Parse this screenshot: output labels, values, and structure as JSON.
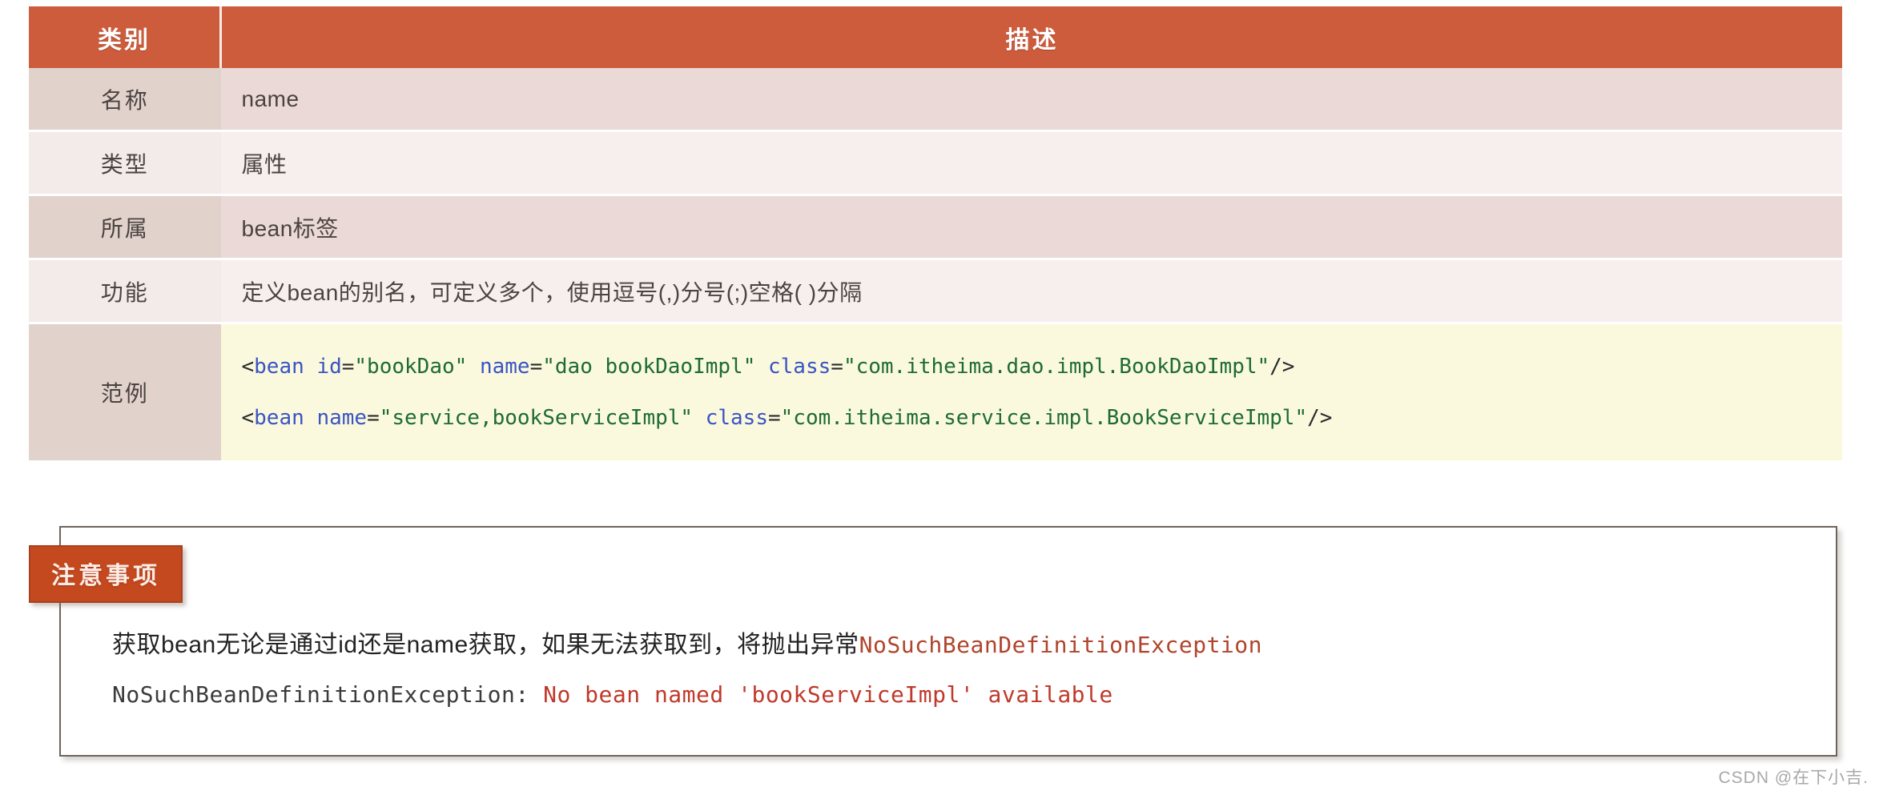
{
  "table": {
    "headers": [
      "类别",
      "描述"
    ],
    "rows": [
      {
        "category": "名称",
        "value": "name"
      },
      {
        "category": "类型",
        "value": "属性"
      },
      {
        "category": "所属",
        "value": "bean标签"
      },
      {
        "category": "功能",
        "value": "定义bean的别名，可定义多个，使用逗号(,)分号(;)空格( )分隔"
      }
    ],
    "example": {
      "category": "范例",
      "lines": [
        {
          "tokens": [
            {
              "t": "<",
              "k": "punc"
            },
            {
              "t": "bean",
              "k": "tag"
            },
            {
              "t": " ",
              "k": "punc"
            },
            {
              "t": "id",
              "k": "attr"
            },
            {
              "t": "=",
              "k": "punc"
            },
            {
              "t": "\"bookDao\"",
              "k": "str"
            },
            {
              "t": " ",
              "k": "punc"
            },
            {
              "t": "name",
              "k": "attr"
            },
            {
              "t": "=",
              "k": "punc"
            },
            {
              "t": "\"dao bookDaoImpl\"",
              "k": "str"
            },
            {
              "t": " ",
              "k": "punc"
            },
            {
              "t": "class",
              "k": "attr"
            },
            {
              "t": "=",
              "k": "punc"
            },
            {
              "t": "\"com.itheima.dao.impl.BookDaoImpl\"",
              "k": "str"
            },
            {
              "t": "/>",
              "k": "punc"
            }
          ]
        },
        {
          "tokens": [
            {
              "t": "<",
              "k": "punc"
            },
            {
              "t": "bean",
              "k": "tag"
            },
            {
              "t": " ",
              "k": "punc"
            },
            {
              "t": "name",
              "k": "attr"
            },
            {
              "t": "=",
              "k": "punc"
            },
            {
              "t": "\"service,bookServiceImpl\"",
              "k": "str"
            },
            {
              "t": " ",
              "k": "punc"
            },
            {
              "t": "class",
              "k": "attr"
            },
            {
              "t": "=",
              "k": "punc"
            },
            {
              "t": "\"com.itheima.service.impl.BookServiceImpl\"",
              "k": "str"
            },
            {
              "t": "/>",
              "k": "punc"
            }
          ]
        }
      ]
    }
  },
  "note": {
    "badge_label": "注意事项",
    "line1_prefix": "获取bean无论是通过id还是name获取，如果无法获取到，将抛出异常",
    "line1_exception": "NoSuchBeanDefinitionException",
    "line2_prefix": "NoSuchBeanDefinitionException: ",
    "line2_message": "No bean named 'bookServiceImpl' available"
  },
  "watermark": "CSDN @在下小吉.",
  "colors": {
    "header_bg": "#cd5c3c",
    "band_dark_cat": "#e2d2cc",
    "band_dark_val": "#ead9d6",
    "band_light_cat": "#f3eaea",
    "band_light_val": "#f7eeee",
    "code_bg": "#fbf9dd",
    "badge_bg": "#c4491f",
    "note_border": "#6d645c",
    "code_tag": "#3a54c4",
    "code_string": "#1d6b35",
    "error_red": "#c0392b"
  }
}
